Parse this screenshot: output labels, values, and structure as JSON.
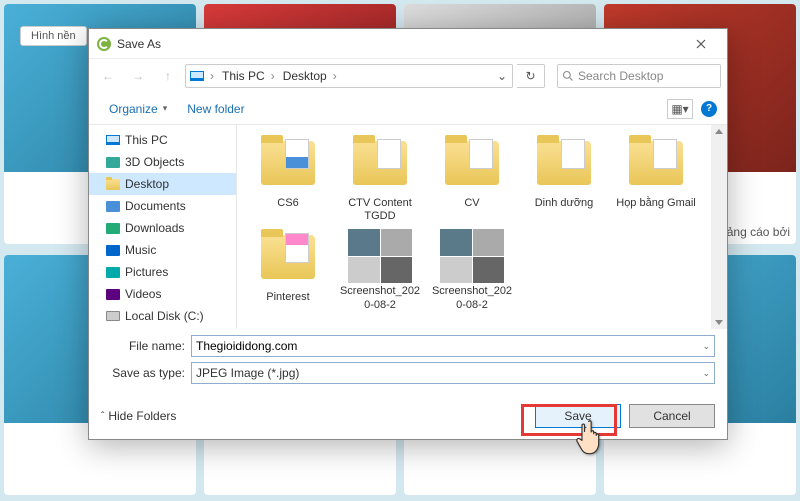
{
  "bg_tag": "Hình nền",
  "side_text": "ảng cáo bởi",
  "dialog": {
    "title": "Save As",
    "breadcrumb": {
      "root": "This PC",
      "folder": "Desktop"
    },
    "search_placeholder": "Search Desktop",
    "toolbar": {
      "organize": "Organize",
      "new_folder": "New folder"
    },
    "tree": [
      {
        "label": "This PC",
        "icon": "pc"
      },
      {
        "label": "3D Objects",
        "icon": "folder"
      },
      {
        "label": "Desktop",
        "icon": "folder",
        "selected": true
      },
      {
        "label": "Documents",
        "icon": "folder"
      },
      {
        "label": "Downloads",
        "icon": "folder"
      },
      {
        "label": "Music",
        "icon": "folder"
      },
      {
        "label": "Pictures",
        "icon": "folder"
      },
      {
        "label": "Videos",
        "icon": "folder"
      },
      {
        "label": "Local Disk (C:)",
        "icon": "drive"
      }
    ],
    "files": [
      {
        "name": "CS6",
        "type": "folder",
        "doc": "blue"
      },
      {
        "name": "CTV Content TGDD",
        "type": "folder",
        "doc": "plain"
      },
      {
        "name": "CV",
        "type": "folder",
        "doc": "plain"
      },
      {
        "name": "Dinh dưỡng",
        "type": "folder",
        "doc": "plain"
      },
      {
        "name": "Họp bằng Gmail",
        "type": "folder",
        "doc": "plain"
      },
      {
        "name": "Pinterest",
        "type": "folder",
        "doc": "pink"
      },
      {
        "name": "Screenshot_2020-08-2",
        "type": "image"
      },
      {
        "name": "Screenshot_2020-08-2",
        "type": "image"
      }
    ],
    "file_name_label": "File name:",
    "file_name_value": "Thegioididong.com",
    "save_type_label": "Save as type:",
    "save_type_value": "JPEG Image (*.jpg)",
    "hide_folders": "Hide Folders",
    "save_label": "Save",
    "cancel_label": "Cancel"
  }
}
